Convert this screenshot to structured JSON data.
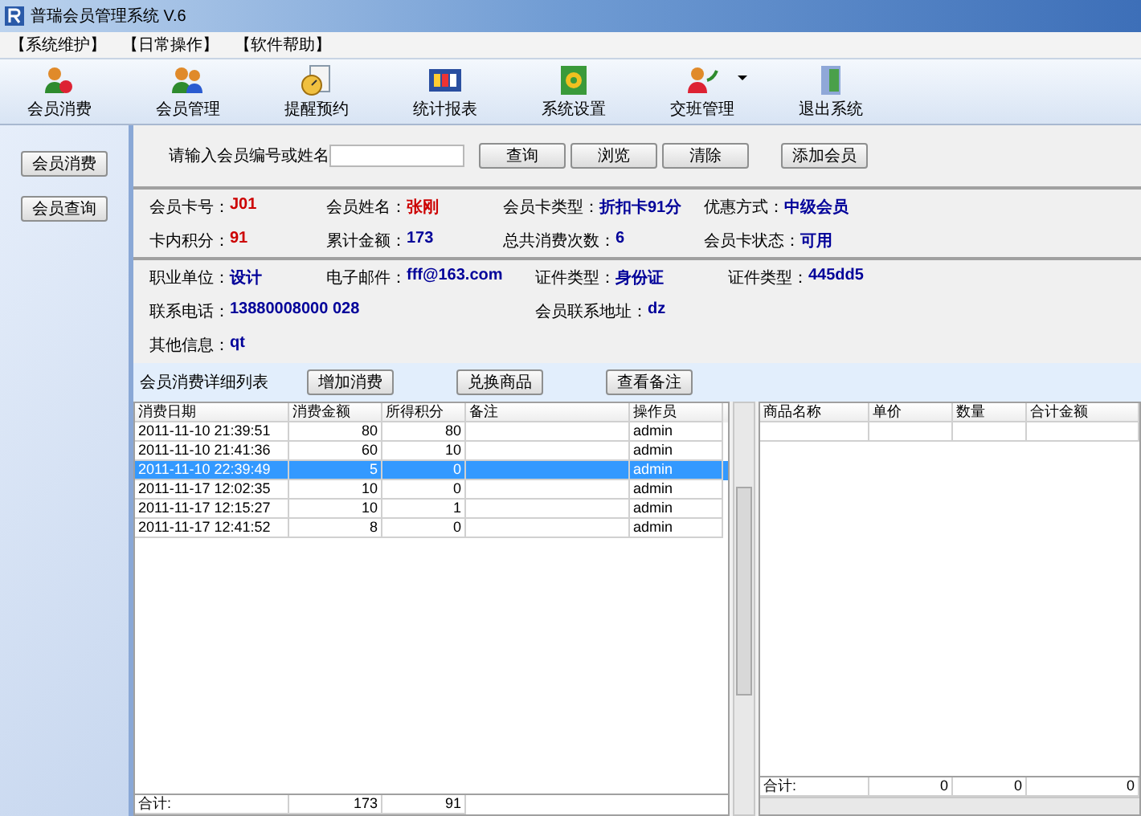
{
  "window": {
    "title": "普瑞会员管理系统 V.6"
  },
  "menu": [
    "【系统维护】",
    "【日常操作】",
    "【软件帮助】"
  ],
  "toolbar": [
    {
      "label": "会员消费",
      "kind": "users",
      "dropdown": false
    },
    {
      "label": "会员管理",
      "kind": "group",
      "dropdown": false
    },
    {
      "label": "提醒预约",
      "kind": "clock",
      "dropdown": false
    },
    {
      "label": "统计报表",
      "kind": "chart",
      "dropdown": false
    },
    {
      "label": "系统设置",
      "kind": "gear",
      "dropdown": false
    },
    {
      "label": "交班管理",
      "kind": "exchange",
      "dropdown": true
    },
    {
      "label": "退出系统",
      "kind": "door",
      "dropdown": false
    }
  ],
  "sidebar": {
    "items": [
      "会员消费",
      "会员查询"
    ]
  },
  "search": {
    "label": "请输入会员编号或姓名",
    "buttons": [
      "查询",
      "浏览",
      "清除"
    ],
    "add_button": "添加会员"
  },
  "card_info": [
    [
      {
        "label": "会员卡号：",
        "value": "J01",
        "color": "#cc0000"
      },
      {
        "label": "会员姓名：",
        "value": "张刚",
        "color": "#cc0000"
      },
      {
        "label": "会员卡类型：",
        "value": "折扣卡91分",
        "color": "#000099"
      },
      {
        "label": "优惠方式：",
        "value": "中级会员",
        "color": "#000099"
      }
    ],
    [
      {
        "label": "卡内积分：",
        "value": "91",
        "color": "#cc0000"
      },
      {
        "label": "累计金额：",
        "value": "173",
        "color": "#000099"
      },
      {
        "label": "总共消费次数：",
        "value": "6",
        "color": "#000099"
      },
      {
        "label": "会员卡状态：",
        "value": "可用",
        "color": "#000099"
      }
    ]
  ],
  "personal_info": [
    [
      {
        "label": "职业单位：",
        "value": "设计"
      },
      {
        "label": "电子邮件：",
        "value": "fff@163.com"
      },
      {
        "label": "证件类型：",
        "value": "身份证"
      },
      {
        "label": "证件类型：",
        "value": "445dd5"
      }
    ],
    [
      {
        "label": "联系电话：",
        "value": "13880008000  028"
      },
      {
        "label": "会员联系地址：",
        "value": "dz"
      }
    ],
    [
      {
        "label": "其他信息：",
        "value": "qt"
      }
    ]
  ],
  "list_bar": {
    "title": "会员消费详细列表",
    "buttons": [
      "增加消费",
      "兑换商品",
      "查看备注"
    ]
  },
  "consumption_table": {
    "columns": [
      "消费日期",
      "消费金额",
      "所得积分",
      "备注",
      "操作员"
    ],
    "rows": [
      {
        "cells": [
          "2011-11-10 21:39:51",
          "80",
          "80",
          "",
          "admin"
        ],
        "selected": false
      },
      {
        "cells": [
          "2011-11-10 21:41:36",
          "60",
          "10",
          "",
          "admin"
        ],
        "selected": false
      },
      {
        "cells": [
          "2011-11-10 22:39:49",
          "5",
          "0",
          "",
          "admin"
        ],
        "selected": true
      },
      {
        "cells": [
          "2011-11-17 12:02:35",
          "10",
          "0",
          "",
          "admin"
        ],
        "selected": false
      },
      {
        "cells": [
          "2011-11-17 12:15:27",
          "10",
          "1",
          "",
          "admin"
        ],
        "selected": false
      },
      {
        "cells": [
          "2011-11-17 12:41:52",
          "8",
          "0",
          "",
          "admin"
        ],
        "selected": false
      }
    ],
    "totals": [
      "合计:",
      "173",
      "91"
    ]
  },
  "goods_table": {
    "columns": [
      "商品名称",
      "单价",
      "数量",
      "合计金额"
    ],
    "totals": [
      "合计:",
      "0",
      "0",
      "0"
    ]
  }
}
